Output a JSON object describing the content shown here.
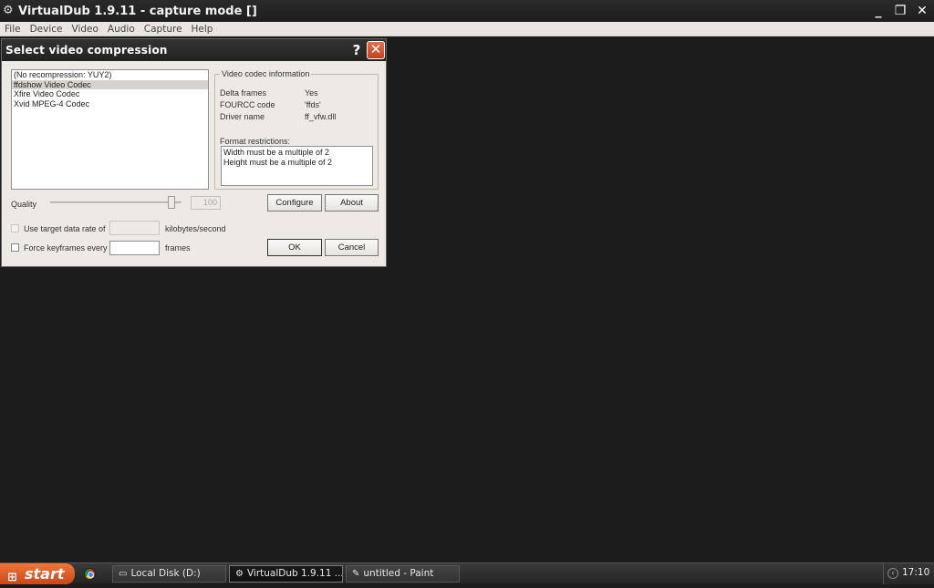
{
  "app": {
    "title": "VirtualDub 1.9.11 - capture mode []",
    "icon": "gears-icon",
    "window_controls": [
      "_",
      "❐",
      "✕"
    ]
  },
  "menu": [
    "File",
    "Device",
    "Video",
    "Audio",
    "Capture",
    "Help"
  ],
  "dialog": {
    "title": "Select video compression",
    "help_glyph": "?",
    "close_glyph": "✕",
    "codecs": [
      {
        "label": "(No recompression: YUY2)",
        "selected": false
      },
      {
        "label": "ffdshow Video Codec",
        "selected": true
      },
      {
        "label": "Xfire Video Codec",
        "selected": false
      },
      {
        "label": "Xvid MPEG-4 Codec",
        "selected": false
      }
    ],
    "info": {
      "legend": "Video codec information",
      "rows": [
        {
          "label": "Delta frames",
          "value": "Yes"
        },
        {
          "label": "FOURCC code",
          "value": "'ffds'"
        },
        {
          "label": "Driver name",
          "value": "ff_vfw.dll"
        }
      ],
      "restrictions_label": "Format restrictions:",
      "restrictions": [
        "Width must be a multiple of 2",
        "Height must be a multiple of 2"
      ]
    },
    "quality_label": "Quality",
    "quality_value": "100",
    "quality_fraction": 0.95,
    "configure_label": "Configure",
    "about_label": "About",
    "target_rate_label": "Use target data rate of",
    "target_rate_unit": "kilobytes/second",
    "keyframes_label": "Force keyframes every",
    "keyframes_unit": "frames",
    "ok_label": "OK",
    "cancel_label": "Cancel"
  },
  "taskbar": {
    "start_label": "start",
    "tasks": [
      {
        "label": "Local Disk (D:)",
        "icon": "drive-icon"
      },
      {
        "label": "VirtualDub 1.9.11 ...",
        "icon": "gears-icon",
        "active": true
      },
      {
        "label": "untitled - Paint",
        "icon": "paint-icon"
      }
    ],
    "clock": "17:10"
  }
}
